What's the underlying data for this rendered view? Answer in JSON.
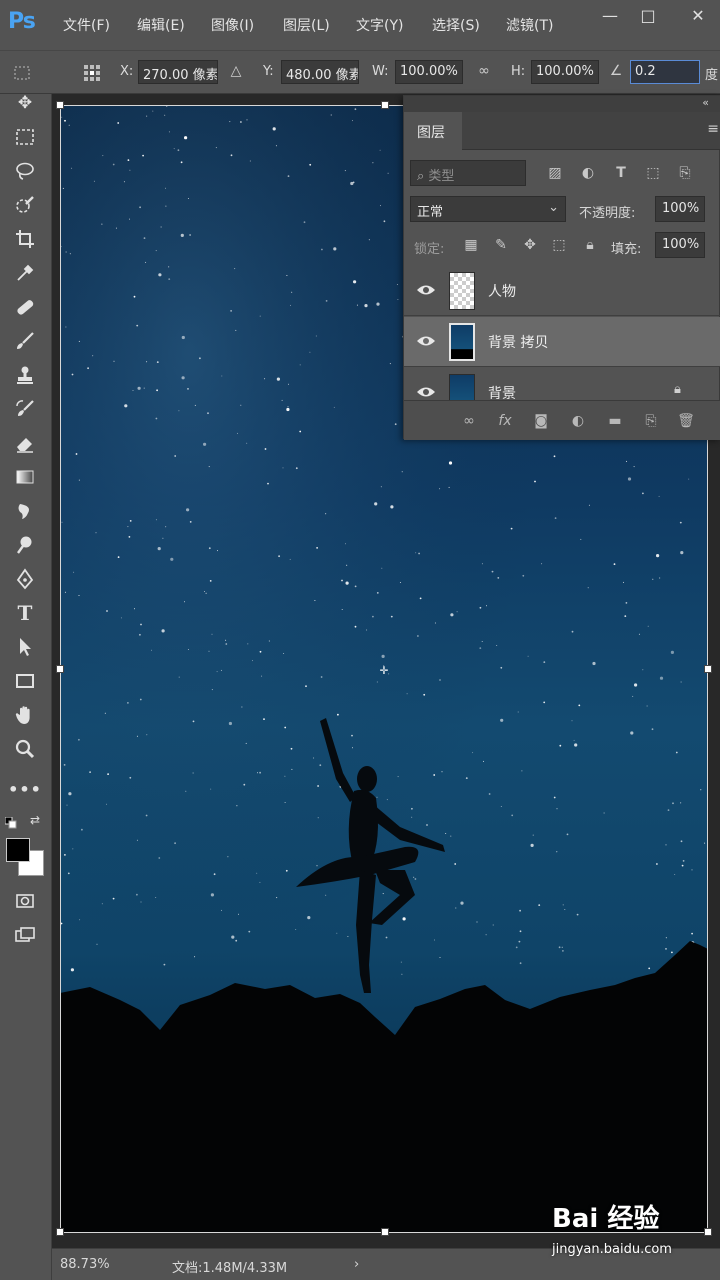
{
  "app": {
    "logo": "Ps"
  },
  "menu": [
    {
      "label": "文件(F)"
    },
    {
      "label": "编辑(E)"
    },
    {
      "label": "图像(I)"
    },
    {
      "label": "图层(L)"
    },
    {
      "label": "文字(Y)"
    },
    {
      "label": "选择(S)"
    },
    {
      "label": "滤镜(T)"
    }
  ],
  "window": {
    "minimize": "—",
    "restore": "□",
    "close": "✕"
  },
  "options": {
    "x_label": "X:",
    "x_value": "270.00 像素",
    "y_label": "Y:",
    "y_value": "480.00 像素",
    "w_label": "W:",
    "w_value": "100.00%",
    "h_label": "H:",
    "h_value": "100.00%",
    "angle_value": "0.2",
    "angle_unit": "度"
  },
  "tools": [
    "move-icon",
    "marquee-icon",
    "lasso-icon",
    "quick-select-icon",
    "crop-icon",
    "eyedropper-icon",
    "healing-icon",
    "brush-icon",
    "stamp-icon",
    "history-brush-icon",
    "eraser-icon",
    "gradient-icon",
    "blur-icon",
    "dodge-icon",
    "pen-icon",
    "type-icon",
    "path-select-icon",
    "rectangle-icon",
    "hand-icon",
    "zoom-icon",
    "more-icon"
  ],
  "colors": {
    "foreground": "#000000",
    "background": "#ffffff",
    "sky_top": "#0c2a49",
    "sky_mid": "#134a70"
  },
  "layers_panel": {
    "tab": "图层",
    "filter_placeholder": "类型",
    "blend_mode": "正常",
    "opacity_label": "不透明度:",
    "opacity_value": "100%",
    "lock_label": "锁定:",
    "fill_label": "填充:",
    "fill_value": "100%",
    "layers": [
      {
        "name": "人物",
        "visible": true,
        "selected": false,
        "thumb": "transparent"
      },
      {
        "name": "背景 拷贝",
        "visible": true,
        "selected": true,
        "thumb": "night"
      },
      {
        "name": "背景",
        "visible": true,
        "selected": false,
        "thumb": "night",
        "locked": true
      }
    ]
  },
  "status": {
    "zoom": "88.73%",
    "doc": "文档:1.48M/4.33M",
    "arrow": "›"
  },
  "watermark": {
    "logo": "Bai 经验",
    "url": "jingyan.baidu.com"
  }
}
